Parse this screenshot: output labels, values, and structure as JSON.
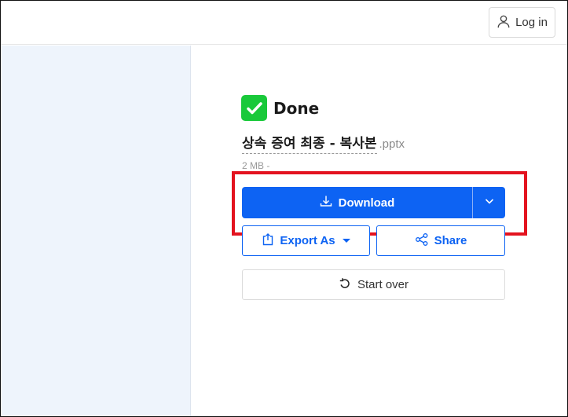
{
  "header": {
    "login_label": "Log in",
    "login_icon": "user-icon"
  },
  "result": {
    "status_label": "Done",
    "status_icon": "checkmark-icon",
    "file_name": "상속 증여 최종 - 복사본",
    "file_ext": ".pptx",
    "file_meta": "2 MB -"
  },
  "actions": {
    "download_label": "Download",
    "export_label": "Export As",
    "share_label": "Share",
    "startover_label": "Start over"
  },
  "colors": {
    "primary": "#0d63f3",
    "success": "#19c93a",
    "highlight": "#e3131f",
    "sidebar_bg": "#eef4fc"
  }
}
